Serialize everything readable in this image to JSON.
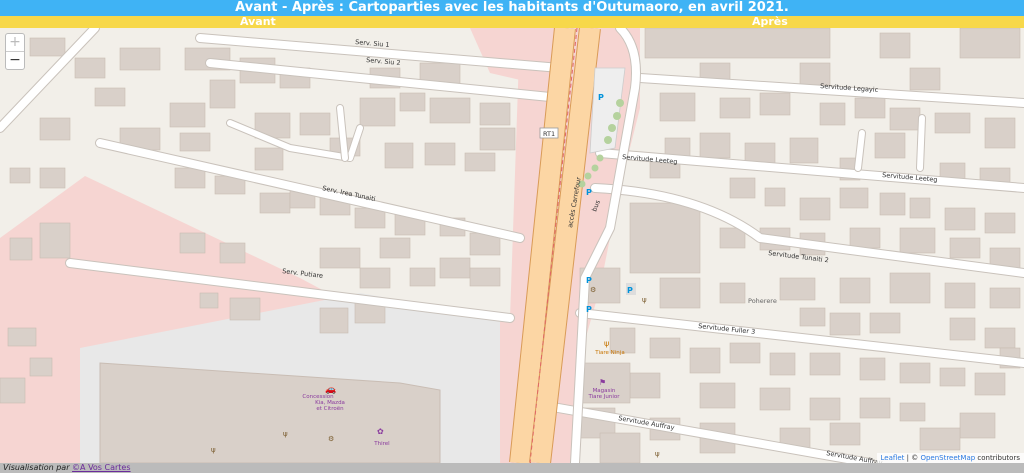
{
  "header": {
    "title": "Avant - Après : Cartoparties avec les habitants d'Outumaoro, en avril 2021.",
    "before_label": "Avant",
    "after_label": "Après"
  },
  "map": {
    "zoom_in": "+",
    "zoom_out": "−",
    "road_labels": {
      "serv_siu_1": "Serv. Siu 1",
      "serv_siu_2": "Serv. Siu 2",
      "rt1": "RT1",
      "serv_irea_tunaiti": "Serv. Irea Tunaiti",
      "serv_putiare": "Serv. Putiare",
      "servitude_legayic": "Servitude Legayic",
      "servitude_leeteg_1": "Servitude Leeteg",
      "servitude_leeteg_2": "Servitude Leeteg",
      "servitude_tunaiti_2": "Servitude Tunaiti 2",
      "servitude_fuller_3": "Servitude Fuller 3",
      "servitude_auffray_1": "Servitude Auffray",
      "servitude_auffray_2": "Servitude Auffray",
      "acces_carrefour": "accès Carrefour",
      "bus_lane": "bus"
    },
    "poi_labels": {
      "concession": "Concession\nKia, Mazda\net Citroën",
      "concession_l1": "Concession",
      "concession_l2": "Kia, Mazda",
      "concession_l3": "et Citroën",
      "thirel": "Thirel",
      "fare_ninja": "Tiare Ninja",
      "magasin_1": "Magasin",
      "magasin_2": "Tiare Junior",
      "poheree": "Poherere"
    },
    "colors": {
      "background": "#f2efe9",
      "building": "#d9d0c9",
      "residential_pink": "#f6d5d2",
      "primary_road": "#fcd6a4",
      "primary_casing": "#d99b57",
      "commercial": "#eaeaea"
    },
    "attribution": {
      "leaflet": "Leaflet",
      "separator": "| ©",
      "osm": "OpenStreetMap",
      "contributors": "contributors"
    }
  },
  "footer": {
    "prefix": "Visualisation par",
    "link": "©A Vos Cartes"
  }
}
